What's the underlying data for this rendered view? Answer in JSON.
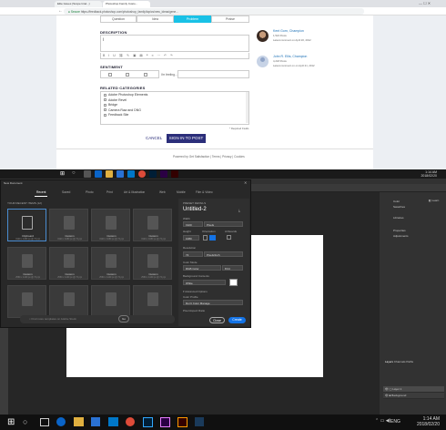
{
  "browser": {
    "tabs": [
      {
        "label": "Elite Issues (Scope Intel...)"
      },
      {
        "label": "Photoshop Family Custo..."
      }
    ],
    "url": "https://feedback.photoshop.com/photoshop_family/topics/new_ideas/gene...",
    "secure_label": "Secure"
  },
  "form": {
    "segments": [
      "Question",
      "Idea",
      "Problem",
      "Praise"
    ],
    "selected_segment": "Problem",
    "description_label": "DESCRIPTION",
    "description_value": "|",
    "sentiment_label": "SENTIMENT",
    "sentiment_note": "I'm feeling...",
    "categories_label": "RELATED CATEGORIES",
    "categories": [
      "Adobe Photoshop Elements",
      "Adobe Revel",
      "Bridge",
      "Camera Raw and DNG",
      "Feedback Site"
    ],
    "required_note": "* Required Fields",
    "cancel_label": "CANCEL",
    "submit_label": "SIGN IN TO POST",
    "footer_powered": "Powered by Get Satisfaction",
    "footer_links": [
      "Terms",
      "Privacy",
      "Cookies"
    ]
  },
  "champions": [
    {
      "name": "Kent Gorn, Champion",
      "meta1": "1,524 Posts",
      "meta2": "Latest comment on April 20, 2012"
    },
    {
      "name": "John R. Ellis, Champion",
      "meta1": "4,218 Posts",
      "meta2": "Latest comment on on April 21, 2012"
    }
  ],
  "top_taskbar": {
    "time": "1:14 AM",
    "date": "2018/02/20"
  },
  "bottom_taskbar": {
    "time": "1:14 AM",
    "date": "2018/02/20",
    "lang": "ENG"
  },
  "new_document": {
    "title": "New Document",
    "tabs": [
      "Recent",
      "Saved",
      "Photo",
      "Print",
      "Art & Illustration",
      "Web",
      "Mobile",
      "Film & Video"
    ],
    "selected_tab": "Recent",
    "recent_label": "YOUR RECENT ITEMS (12)",
    "items": [
      {
        "name": "Clipboard",
        "sub": "1920 x 1080 px @ 72 ppi"
      },
      {
        "name": "Custom",
        "sub": "1920 x 1080 px @ 72 ppi"
      },
      {
        "name": "Custom",
        "sub": "1920 x 1080 px @ 72 ppi"
      },
      {
        "name": "Custom",
        "sub": "1920 x 1080 px @ 72 ppi"
      },
      {
        "name": "Custom",
        "sub": "2560 x 1440 px @ 72 ppi"
      },
      {
        "name": "Custom",
        "sub": "2560 x 1440 px @ 72 ppi"
      },
      {
        "name": "Custom",
        "sub": "2560 x 1440 px @ 72 ppi"
      },
      {
        "name": "Custom",
        "sub": "2560 x 1440 px @ 72 ppi"
      },
      {
        "name": "",
        "sub": ""
      },
      {
        "name": "",
        "sub": ""
      },
      {
        "name": "",
        "sub": ""
      },
      {
        "name": "",
        "sub": ""
      }
    ],
    "search_placeholder": "Find more templates on Adobe Stock",
    "go_label": "Go",
    "details_label": "PRESET DETAILS",
    "doc_name": "Untitled-2",
    "width_label": "Width",
    "width_value": "1920",
    "width_unit": "Pixels",
    "height_label": "Height",
    "height_value": "1080",
    "orientation_label": "Orientation",
    "artboards_label": "Artboards",
    "resolution_label": "Resolution",
    "resolution_value": "72",
    "resolution_unit": "Pixels/Inch",
    "color_mode_label": "Color Mode",
    "color_mode_value": "RGB Color",
    "bit_depth": "8 bit",
    "bg_label": "Background Contents",
    "bg_value": "White",
    "advanced_label": "Advanced Options",
    "profile_label": "Color Profile",
    "profile_value": "Don't Color Manage",
    "pixel_label": "Pixel Aspect Ratio",
    "close_label": "Close",
    "create_label": "Create"
  },
  "panels": {
    "items": [
      "Color",
      "Swatches",
      "Libraries",
      "Properties",
      "Adjustments"
    ],
    "layers_tabs": [
      "Layers",
      "Channels",
      "Paths"
    ],
    "layers": [
      "Layer 1",
      "Background"
    ]
  },
  "colors": {
    "accent": "#2b2e7a",
    "selected_segment": "#19c1e6",
    "ps_blue": "#1473e6"
  }
}
